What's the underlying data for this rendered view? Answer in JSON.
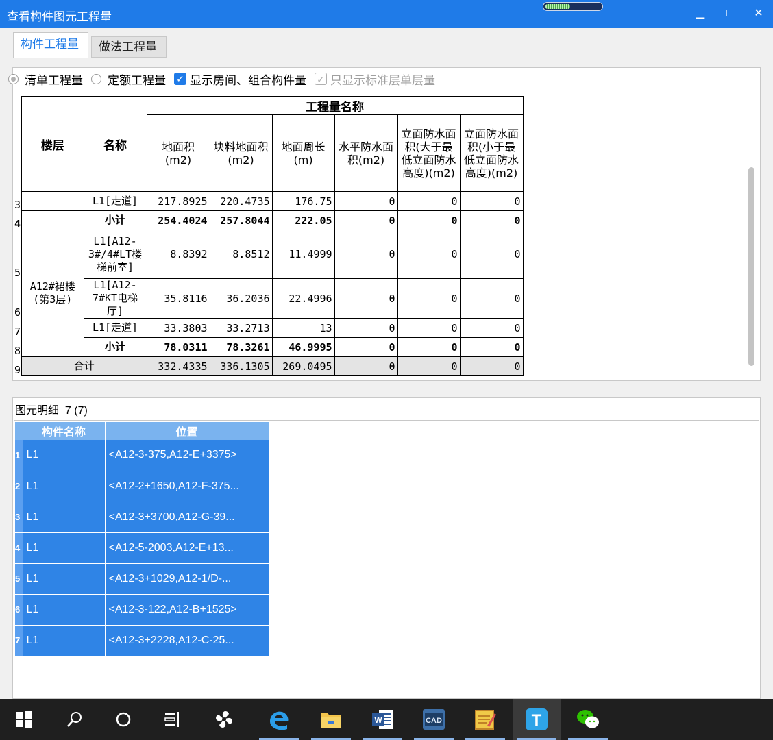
{
  "window": {
    "title": "查看构件图元工程量",
    "loading_progress": 0.45,
    "controls": {
      "minimize": "▁",
      "maximize": "□",
      "close": "✕"
    }
  },
  "tabs": [
    {
      "label": "构件工程量",
      "active": true
    },
    {
      "label": "做法工程量",
      "active": false
    }
  ],
  "options": {
    "radio_list": "清单工程量",
    "radio_quota": "定额工程量",
    "check_rooms": "显示房间、组合构件量",
    "check_standard": "只显示标准层单层量"
  },
  "qty_table": {
    "col_floor": "楼层",
    "col_name": "名称",
    "group_header": "工程量名称",
    "columns": [
      "地面积(m2)",
      "块料地面积(m2)",
      "地面周长(m)",
      "水平防水面积(m2)",
      "立面防水面积(大于最低立面防水高度)(m2)",
      "立面防水面积(小于最低立面防水高度)(m2)"
    ],
    "rows": [
      {
        "rownum": "3",
        "name": "L1[走道]",
        "values": [
          "217.8925",
          "220.4735",
          "176.75",
          "0",
          "0",
          "0"
        ]
      },
      {
        "rownum": "4",
        "name": "小计",
        "values": [
          "254.4024",
          "257.8044",
          "222.05",
          "0",
          "0",
          "0"
        ]
      },
      {
        "rownum": "5",
        "floor": "A12#裙楼(第3层)",
        "name": "L1[A12-3#/4#LT楼梯前室]",
        "values": [
          "8.8392",
          "8.8512",
          "11.4999",
          "0",
          "0",
          "0"
        ]
      },
      {
        "rownum": "6",
        "name": "L1[A12-7#KT电梯厅]",
        "values": [
          "35.8116",
          "36.2036",
          "22.4996",
          "0",
          "0",
          "0"
        ]
      },
      {
        "rownum": "7",
        "name": "L1[走道]",
        "values": [
          "33.3803",
          "33.2713",
          "13",
          "0",
          "0",
          "0"
        ]
      },
      {
        "rownum": "8",
        "name": "小计",
        "values": [
          "78.0311",
          "78.3261",
          "46.9995",
          "0",
          "0",
          "0"
        ]
      },
      {
        "rownum": "9",
        "name": "合计",
        "values": [
          "332.4335",
          "336.1305",
          "269.0495",
          "0",
          "0",
          "0"
        ]
      }
    ]
  },
  "detail": {
    "label": "图元明细",
    "count": "7 (7)",
    "headers": [
      "构件名称",
      "位置"
    ],
    "rows": [
      {
        "idx": "1",
        "name": "L1",
        "pos": "<A12-3-375,A12-E+3375>"
      },
      {
        "idx": "2",
        "name": "L1",
        "pos": "<A12-2+1650,A12-F-375..."
      },
      {
        "idx": "3",
        "name": "L1",
        "pos": "<A12-3+3700,A12-G-39..."
      },
      {
        "idx": "4",
        "name": "L1",
        "pos": "<A12-5-2003,A12-E+13..."
      },
      {
        "idx": "5",
        "name": "L1",
        "pos": "<A12-3+1029,A12-1/D-..."
      },
      {
        "idx": "6",
        "name": "L1",
        "pos": "<A12-3-122,A12-B+1525>"
      },
      {
        "idx": "7",
        "name": "L1",
        "pos": "<A12-3+2228,A12-C-25..."
      }
    ]
  },
  "taskbar": {
    "items": [
      "start-icon",
      "search-icon",
      "cortana-icon",
      "task-view-icon",
      "fan-app-icon",
      "edge-icon",
      "file-explorer-icon",
      "word-icon",
      "cad-icon",
      "notes-icon",
      "t-app-icon",
      "wechat-icon"
    ],
    "app_labels": {
      "word": "W",
      "cad": "CAD",
      "tapp": "T"
    }
  }
}
